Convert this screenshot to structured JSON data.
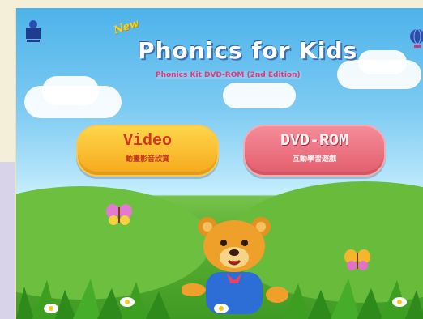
{
  "app": {
    "title_new": "New",
    "title_main": "Phonics for Kids",
    "subtitle": "Phonics Kit DVD-ROM (2nd Edition)"
  },
  "menu": {
    "video": {
      "label": "Video",
      "sub": "動畫影音欣賞"
    },
    "dvd_rom": {
      "label": "DVD-ROM",
      "sub": "互動學習遊戲"
    }
  },
  "colors": {
    "sky": "#4db3ea",
    "grass": "#5db134",
    "video_button": "#f6a81b",
    "dvd_button": "#e35d6c",
    "title_text": "#ffffff",
    "subtitle_text": "#e9357a"
  },
  "icons": [
    "publisher-logo-icon",
    "globe-icon",
    "butterfly-icon",
    "bear-character-icon",
    "flower-icon"
  ]
}
